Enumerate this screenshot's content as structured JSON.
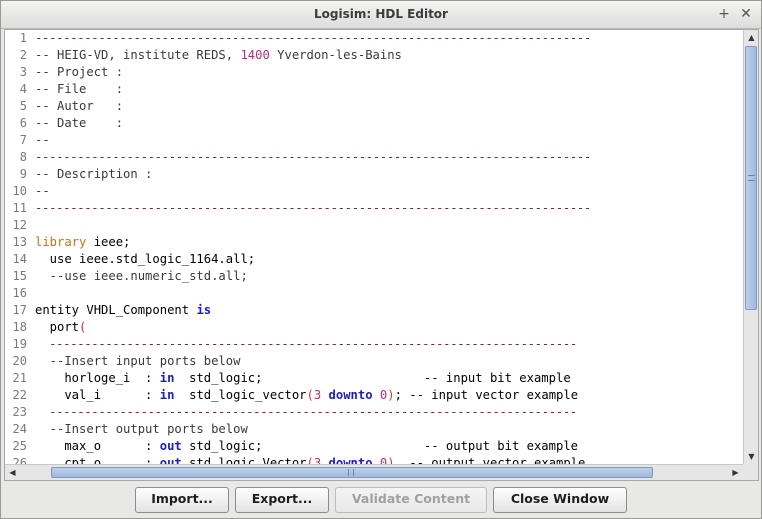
{
  "window": {
    "title": "Logisim: HDL Editor",
    "controls": {
      "maximize_icon": "+",
      "close_icon": "✕"
    }
  },
  "editor": {
    "lines": [
      {
        "num": "1",
        "parts": [
          {
            "t": "-------------------------------------------------------------------------------",
            "c": "dash"
          }
        ]
      },
      {
        "num": "2",
        "parts": [
          {
            "t": "-- HEIG-VD, institute REDS, ",
            "c": "comment"
          },
          {
            "t": "1400",
            "c": "num"
          },
          {
            "t": " Yverdon-les-Bains",
            "c": "comment"
          }
        ]
      },
      {
        "num": "3",
        "parts": [
          {
            "t": "-- Project :",
            "c": "comment"
          }
        ]
      },
      {
        "num": "4",
        "parts": [
          {
            "t": "-- File    :",
            "c": "comment"
          }
        ]
      },
      {
        "num": "5",
        "parts": [
          {
            "t": "-- Autor   :",
            "c": "comment"
          }
        ]
      },
      {
        "num": "6",
        "parts": [
          {
            "t": "-- Date    :",
            "c": "comment"
          }
        ]
      },
      {
        "num": "7",
        "parts": [
          {
            "t": "--",
            "c": "comment"
          }
        ]
      },
      {
        "num": "8",
        "parts": [
          {
            "t": "-------------------------------------------------------------------------------",
            "c": "dash"
          }
        ]
      },
      {
        "num": "9",
        "parts": [
          {
            "t": "-- Description :",
            "c": "comment"
          }
        ]
      },
      {
        "num": "10",
        "parts": [
          {
            "t": "--",
            "c": "comment"
          }
        ]
      },
      {
        "num": "11",
        "parts": [
          {
            "t": "-------------------------------------------------------------------------------",
            "c": "dash"
          }
        ]
      },
      {
        "num": "12",
        "parts": []
      },
      {
        "num": "13",
        "parts": [
          {
            "t": "library",
            "c": "kw-orange"
          },
          {
            "t": " ieee;",
            "c": "plain"
          }
        ]
      },
      {
        "num": "14",
        "parts": [
          {
            "t": "  use ieee.std_logic_1164.all;",
            "c": "plain"
          }
        ]
      },
      {
        "num": "15",
        "parts": [
          {
            "t": "  --use ieee.numeric_std.all;",
            "c": "comment"
          }
        ]
      },
      {
        "num": "16",
        "parts": []
      },
      {
        "num": "17",
        "parts": [
          {
            "t": "entity VHDL_Component ",
            "c": "plain"
          },
          {
            "t": "is",
            "c": "kw-blue"
          }
        ]
      },
      {
        "num": "18",
        "parts": [
          {
            "t": "  port",
            "c": "plain"
          },
          {
            "t": "(",
            "c": "paren"
          }
        ]
      },
      {
        "num": "19",
        "parts": [
          {
            "t": "  ---------------------------------------------------------------------------",
            "c": "dash"
          }
        ]
      },
      {
        "num": "20",
        "parts": [
          {
            "t": "  --Insert input ports below",
            "c": "comment"
          }
        ]
      },
      {
        "num": "21",
        "parts": [
          {
            "t": "    horloge_i  : ",
            "c": "plain"
          },
          {
            "t": "in",
            "c": "kw-blue"
          },
          {
            "t": "  std_logic;                      -- input bit example",
            "c": "plain"
          }
        ]
      },
      {
        "num": "22",
        "parts": [
          {
            "t": "    val_i      : ",
            "c": "plain"
          },
          {
            "t": "in",
            "c": "kw-blue"
          },
          {
            "t": "  std_logic_vector",
            "c": "plain"
          },
          {
            "t": "(",
            "c": "paren"
          },
          {
            "t": "3",
            "c": "num"
          },
          {
            "t": " ",
            "c": "plain"
          },
          {
            "t": "downto",
            "c": "kw-blue"
          },
          {
            "t": " ",
            "c": "plain"
          },
          {
            "t": "0",
            "c": "num"
          },
          {
            "t": ")",
            "c": "paren"
          },
          {
            "t": "; -- input vector example",
            "c": "plain"
          }
        ]
      },
      {
        "num": "23",
        "parts": [
          {
            "t": "  ---------------------------------------------------------------------------",
            "c": "dash"
          }
        ]
      },
      {
        "num": "24",
        "parts": [
          {
            "t": "  --Insert output ports below",
            "c": "comment"
          }
        ]
      },
      {
        "num": "25",
        "parts": [
          {
            "t": "    max_o      : ",
            "c": "plain"
          },
          {
            "t": "out",
            "c": "kw-blue"
          },
          {
            "t": " std_logic;                      -- output bit example",
            "c": "plain"
          }
        ]
      },
      {
        "num": "26",
        "parts": [
          {
            "t": "    cpt_o      : ",
            "c": "plain"
          },
          {
            "t": "out",
            "c": "kw-blue"
          },
          {
            "t": " std_logic_Vector",
            "c": "plain"
          },
          {
            "t": "(",
            "c": "paren"
          },
          {
            "t": "3",
            "c": "num"
          },
          {
            "t": " ",
            "c": "plain"
          },
          {
            "t": "downto",
            "c": "kw-blue"
          },
          {
            "t": " ",
            "c": "plain"
          },
          {
            "t": "0",
            "c": "num"
          },
          {
            "t": ")",
            "c": "paren"
          },
          {
            "t": "  -- output vector example",
            "c": "plain"
          }
        ]
      }
    ]
  },
  "scrollbars": {
    "up_icon": "▲",
    "down_icon": "▼",
    "left_icon": "◀",
    "right_icon": "▶"
  },
  "buttons": {
    "import": "Import...",
    "export": "Export...",
    "validate": "Validate Content",
    "close": "Close Window"
  }
}
